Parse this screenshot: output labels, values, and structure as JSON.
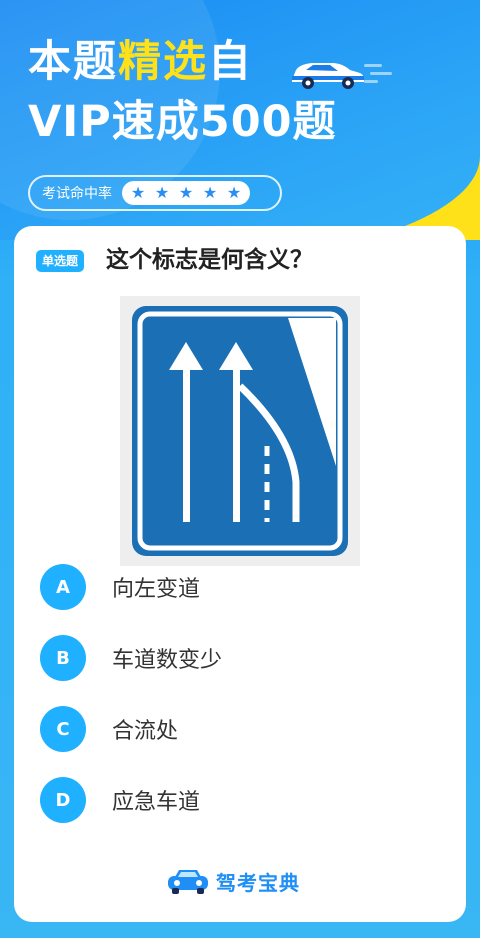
{
  "header": {
    "title_line1_part1": "本题",
    "title_line1_highlight": "精选",
    "title_line1_part2": "自",
    "title_line2": "VIP速成500题",
    "hit_rate_label": "考试命中率",
    "hit_rate_stars": 5
  },
  "question": {
    "type_badge": "单选题",
    "text": "这个标志是何含义？",
    "sign_icon": "lane-reduction-sign-icon"
  },
  "options": [
    {
      "letter": "A",
      "text": "向左变道"
    },
    {
      "letter": "B",
      "text": "车道数变少"
    },
    {
      "letter": "C",
      "text": "合流处"
    },
    {
      "letter": "D",
      "text": "应急车道"
    }
  ],
  "footer": {
    "brand_name": "驾考宝典",
    "brand_icon": "car-icon"
  },
  "colors": {
    "background_blue": "#2aa3f6",
    "highlight_yellow": "#ffe11a",
    "accent_blue": "#1fb0ff",
    "sign_blue": "#1a6fb5"
  }
}
